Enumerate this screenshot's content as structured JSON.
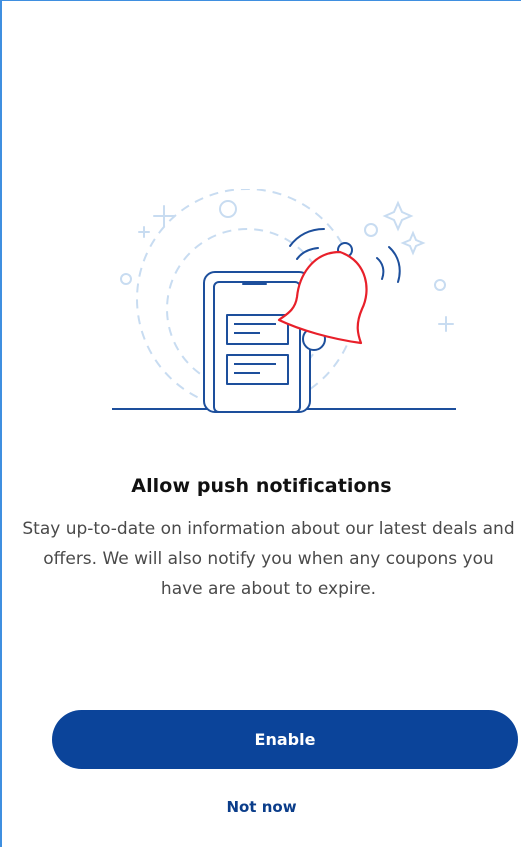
{
  "illustration": {
    "icon": "phone-bell-notification-icon",
    "colors": {
      "outline": "#1d4f9c",
      "bell_stroke": "#e8202a",
      "accent_light": "#c8dcf1"
    }
  },
  "prompt": {
    "title": "Allow push notifications",
    "body": "Stay up-to-date on information about our latest deals and offers. We will also notify you when any coupons you have are about to expire."
  },
  "actions": {
    "enable_label": "Enable",
    "not_now_label": "Not now"
  },
  "colors": {
    "primary": "#0b449a",
    "link": "#0b3d8a",
    "title": "#111111",
    "body": "#4a4a4a"
  }
}
